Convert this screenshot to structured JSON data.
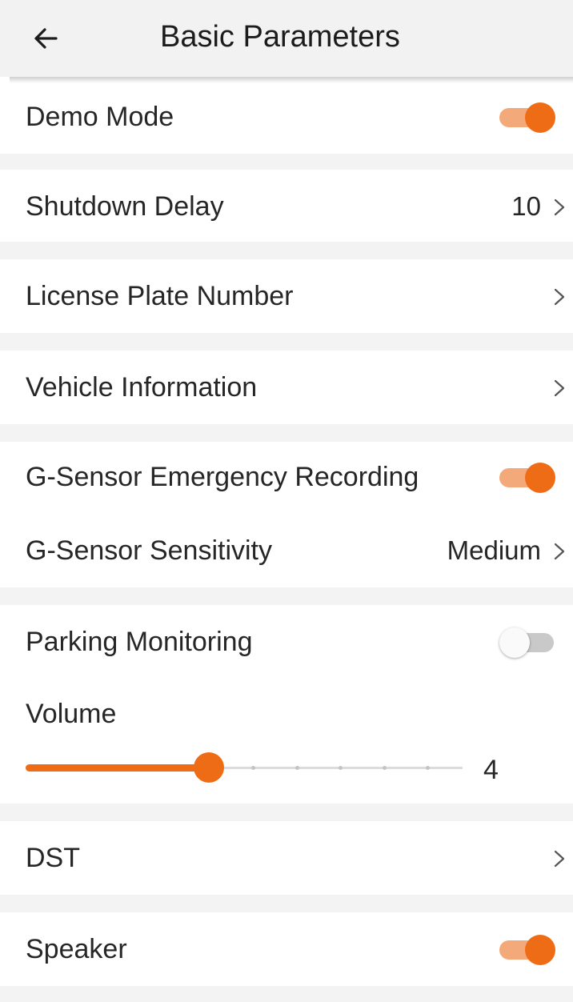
{
  "header": {
    "title": "Basic Parameters",
    "back_icon": "arrow-left-icon"
  },
  "settings": {
    "demo_mode": {
      "label": "Demo Mode",
      "enabled": true
    },
    "shutdown_delay": {
      "label": "Shutdown Delay",
      "value": "10"
    },
    "license_plate": {
      "label": "License Plate Number"
    },
    "vehicle_info": {
      "label": "Vehicle Information"
    },
    "gsensor_recording": {
      "label": "G-Sensor Emergency Recording",
      "enabled": true
    },
    "gsensor_sensitivity": {
      "label": "G-Sensor Sensitivity",
      "value": "Medium"
    },
    "parking_monitoring": {
      "label": "Parking Monitoring",
      "enabled": false
    },
    "volume": {
      "label": "Volume",
      "value": "4",
      "min": 0,
      "max": 10
    },
    "dst": {
      "label": "DST"
    },
    "speaker": {
      "label": "Speaker",
      "enabled": true
    }
  },
  "colors": {
    "accent": "#ef6c16",
    "accent_track": "#f3a97a",
    "header_bg": "#f2f2f2",
    "separator": "#f3f3f3"
  }
}
